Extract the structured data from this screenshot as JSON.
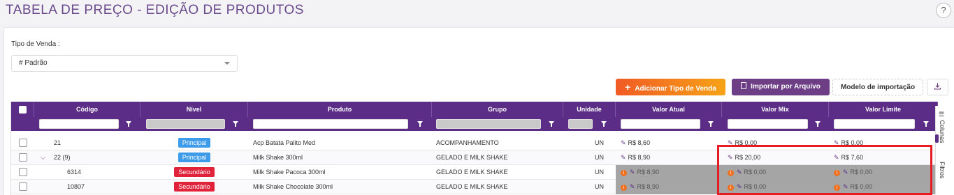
{
  "page": {
    "title": "TABELA DE PREÇO - EDIÇÃO DE PRODUTOS",
    "help": "?"
  },
  "filters": {
    "tipo_venda_label": "Tipo de Venda :",
    "tipo_venda_value": "# Padrão"
  },
  "toolbar": {
    "add_label": "Adicionar Tipo de Venda",
    "import_label": "Importar por Arquivo",
    "model_label": "Modelo de importação",
    "download_icon": "download-icon"
  },
  "table": {
    "columns": [
      "Código",
      "Nível",
      "Produto",
      "Grupo",
      "Unidade",
      "Valor Atual",
      "Valor Mix",
      "Valor Limite"
    ],
    "rows": [
      {
        "codigo": "21",
        "nivel": "Principal",
        "produto": "Acp Batata Palito Med",
        "grupo": "ACOMPANHAMENTO",
        "unidade": "UN",
        "valor_atual": "R$ 8,60",
        "valor_mix": "R$ 0,00",
        "valor_limite": "R$ 0,00"
      },
      {
        "codigo": "22 (9)",
        "expand": "⌵",
        "nivel": "Principal",
        "produto": "Milk Shake 300ml",
        "grupo": "GELADO E MILK SHAKE",
        "unidade": "UN",
        "valor_atual": "R$ 8,90",
        "valor_mix": "R$ 20,00",
        "valor_limite": "R$ 7,60"
      },
      {
        "codigo": "6314",
        "nivel": "Secundário",
        "produto": "Milk Shake Pacoca 300ml",
        "grupo": "GELADO E MILK SHAKE",
        "unidade": "UN",
        "valor_atual": "R$ 8,90",
        "valor_mix": "R$ 0,00",
        "valor_limite": "R$ 0,00"
      },
      {
        "codigo": "10807",
        "nivel": "Secundário",
        "produto": "Milk Shake Chocolate 300ml",
        "grupo": "GELADO E MILK SHAKE",
        "unidade": "UN",
        "valor_atual": "R$ 8,90",
        "valor_mix": "R$ 0,00",
        "valor_limite": "R$ 0,00"
      }
    ]
  },
  "side_panel": {
    "columns_tab": "Colunas",
    "filters_tab": "Filtros"
  },
  "colors": {
    "primary": "#5c2d86",
    "principal_badge": "#3d9be9",
    "secundario_badge": "#e0223b",
    "highlight_box": "#e51c23"
  }
}
